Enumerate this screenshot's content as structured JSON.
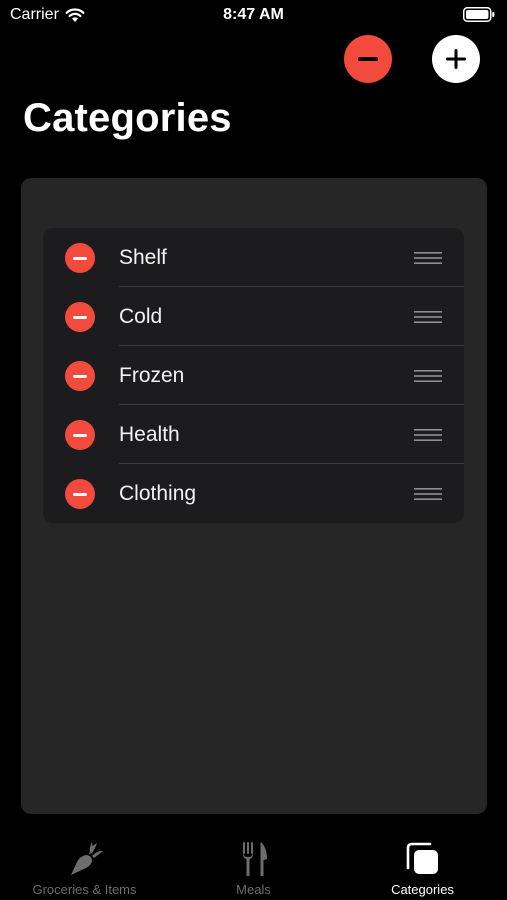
{
  "status_bar": {
    "carrier": "Carrier",
    "time": "8:47 AM"
  },
  "header": {
    "title": "Categories",
    "remove_icon": "minus-circle-icon",
    "add_icon": "plus-circle-icon"
  },
  "categories": [
    {
      "name": "Shelf"
    },
    {
      "name": "Cold"
    },
    {
      "name": "Frozen"
    },
    {
      "name": "Health"
    },
    {
      "name": "Clothing"
    }
  ],
  "tabs": [
    {
      "label": "Groceries & Items",
      "icon": "carrot-icon",
      "active": false
    },
    {
      "label": "Meals",
      "icon": "fork-knife-icon",
      "active": false
    },
    {
      "label": "Categories",
      "icon": "stacked-squares-icon",
      "active": true
    }
  ],
  "colors": {
    "destructive": "#f24a3d",
    "background": "#000000",
    "panel": "#262626",
    "list": "#1c1c1e",
    "tab_inactive": "#6d6d6f",
    "tab_active": "#ffffff"
  }
}
